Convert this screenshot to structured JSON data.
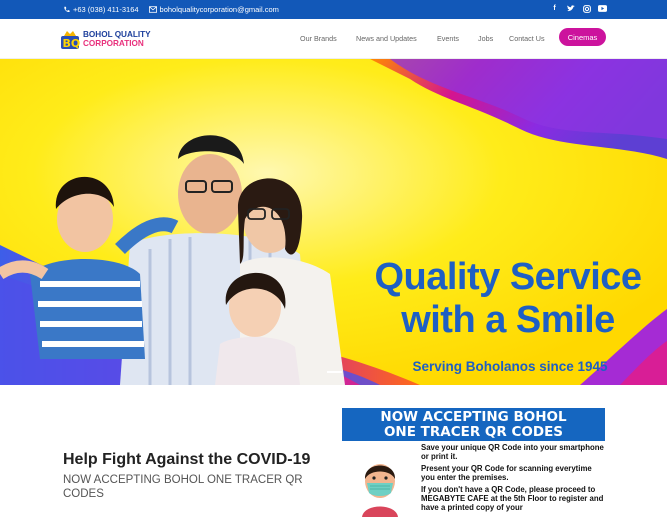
{
  "topbar": {
    "phone": "+63 (038) 411-3164",
    "email": "boholqualitycorporation@gmail.com",
    "social": [
      "facebook-icon",
      "twitter-icon",
      "instagram-icon",
      "youtube-icon"
    ]
  },
  "brand": {
    "line1": "BOHOL QUALITY",
    "line2": "CORPORATION",
    "mark": "BQ"
  },
  "nav": {
    "items": [
      "Our Brands",
      "News and Updates",
      "Events",
      "Jobs",
      "Contact Us"
    ],
    "cta": "Cinemas"
  },
  "hero": {
    "title_line1": "Quality Service",
    "title_line2": "with a Smile",
    "subtitle": "Serving Boholanos since 1945"
  },
  "covid": {
    "title": "Help Fight Against the COVID-19",
    "subtitle": "NOW ACCEPTING BOHOL ONE TRACER QR CODES"
  },
  "poster": {
    "heading_line1": "NOW ACCEPTING BOHOL",
    "heading_line2": "ONE TRACER QR CODES",
    "p1": "Save your unique  QR Code into your smartphone or print it.",
    "p2": "Present your QR Code for scanning everytime you enter the premises.",
    "p3": "If you don't have a QR Code, please proceed to MEGABYTE CAFE at the 5th Floor to register and have a printed copy of your"
  },
  "colors": {
    "topbar": "#1258b8",
    "accent": "#cc139d",
    "hero_text": "#1e5fc4",
    "hero_bg": "#ffe000"
  }
}
